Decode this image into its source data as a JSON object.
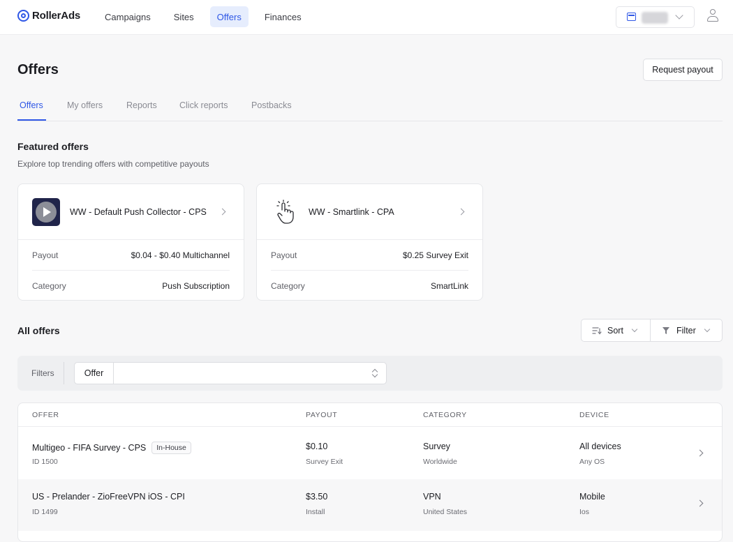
{
  "brand": {
    "name": "RollerAds",
    "accent": "#2f57e6"
  },
  "nav": {
    "items": [
      {
        "label": "Campaigns"
      },
      {
        "label": "Sites"
      },
      {
        "label": "Offers",
        "active": true
      },
      {
        "label": "Finances"
      }
    ]
  },
  "header": {
    "title": "Offers",
    "request_payout_label": "Request payout"
  },
  "tabs": [
    {
      "label": "Offers",
      "active": true
    },
    {
      "label": "My offers"
    },
    {
      "label": "Reports"
    },
    {
      "label": "Click reports"
    },
    {
      "label": "Postbacks"
    }
  ],
  "featured": {
    "title": "Featured offers",
    "subtitle": "Explore top trending offers with competitive payouts",
    "cards": [
      {
        "name": "WW - Default Push Collector - CPS",
        "icon": "play-icon",
        "payout_label": "Payout",
        "payout_value": "$0.04 - $0.40 Multichannel",
        "category_label": "Category",
        "category_value": "Push Subscription"
      },
      {
        "name": "WW - Smartlink - CPA",
        "icon": "pointing-hand-icon",
        "payout_label": "Payout",
        "payout_value": "$0.25 Survey Exit",
        "category_label": "Category",
        "category_value": "SmartLink"
      }
    ]
  },
  "all_offers": {
    "title": "All offers",
    "sort_label": "Sort",
    "filter_label": "Filter",
    "filters_label": "Filters",
    "offer_filter_label": "Offer",
    "offer_filter_value": "",
    "columns": [
      "OFFER",
      "PAYOUT",
      "CATEGORY",
      "DEVICE"
    ],
    "rows": [
      {
        "name": "Multigeo - FIFA Survey - CPS",
        "badge": "In-House",
        "id": "ID 1500",
        "payout": "$0.10",
        "payout_type": "Survey Exit",
        "category": "Survey",
        "geo": "Worldwide",
        "device": "All devices",
        "os": "Any OS"
      },
      {
        "name": "US - Prelander - ZioFreeVPN iOS - CPI",
        "badge": "",
        "id": "ID 1499",
        "payout": "$3.50",
        "payout_type": "Install",
        "category": "VPN",
        "geo": "United States",
        "device": "Mobile",
        "os": "Ios"
      }
    ]
  }
}
